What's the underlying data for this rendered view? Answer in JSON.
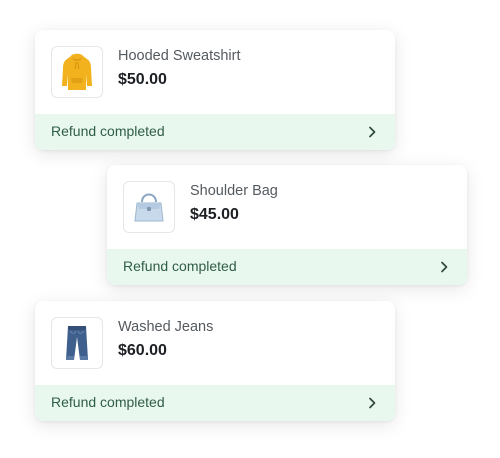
{
  "orders": [
    {
      "product_name": "Hooded Sweatshirt",
      "price": "$50.00",
      "status": "Refund completed",
      "thumbnail_icon": "hoodie-icon",
      "thumbnail_color": "#f2b21e"
    },
    {
      "product_name": "Shoulder Bag",
      "price": "$45.00",
      "status": "Refund completed",
      "thumbnail_icon": "handbag-icon",
      "thumbnail_color": "#b9cfe3"
    },
    {
      "product_name": "Washed Jeans",
      "price": "$60.00",
      "status": "Refund completed",
      "thumbnail_icon": "jeans-icon",
      "thumbnail_color": "#3f5f8c"
    }
  ],
  "colors": {
    "status_background": "#e9f8ef",
    "status_text": "#2f5d46",
    "price_text": "#1c1f23"
  }
}
